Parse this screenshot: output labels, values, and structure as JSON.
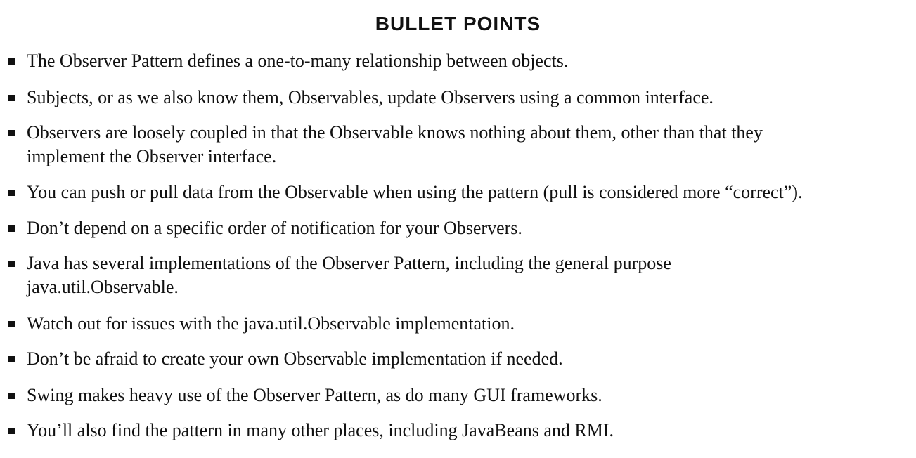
{
  "heading": "BULLET POINTS",
  "bullets": [
    {
      "lines": [
        "The Observer Pattern defines a one-to-many relationship between objects."
      ]
    },
    {
      "lines": [
        "Subjects, or as we also know them, Observables, update Observers using a common interface."
      ]
    },
    {
      "lines": [
        "Observers are loosely coupled in that the Observable knows nothing about them, other than that they",
        "implement the Observer interface."
      ]
    },
    {
      "lines": [
        "You can push or pull data from the Observable when using the pattern (pull is considered more “correct”)."
      ]
    },
    {
      "lines": [
        "Don’t depend on a specific order of notification for your Observers."
      ]
    },
    {
      "lines": [
        "Java has several implementations of the Observer Pattern, including the general purpose",
        "java.util.Observable."
      ]
    },
    {
      "lines": [
        "Watch out for issues with the java.util.Observable implementation."
      ]
    },
    {
      "lines": [
        "Don’t be afraid to create your own Observable implementation if needed."
      ]
    },
    {
      "lines": [
        "Swing makes heavy use of the Observer Pattern, as do many GUI frameworks."
      ]
    },
    {
      "lines": [
        "You’ll also find the pattern in many other places, including JavaBeans and RMI."
      ]
    }
  ]
}
